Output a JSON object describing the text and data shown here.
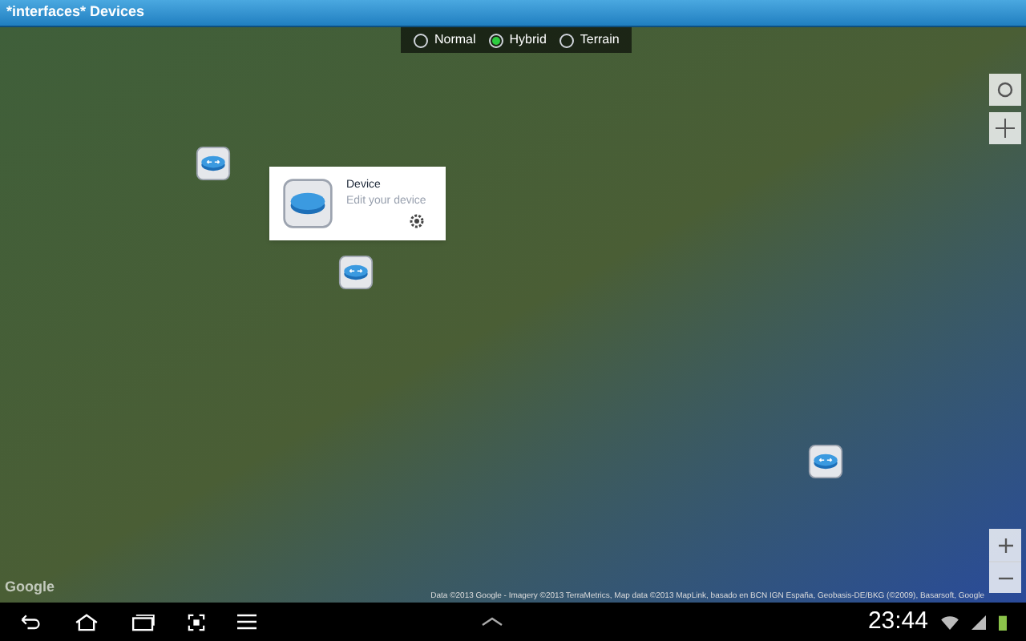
{
  "window": {
    "title": "*interfaces* Devices"
  },
  "map_types": [
    {
      "label": "Normal",
      "selected": false
    },
    {
      "label": "Hybrid",
      "selected": true
    },
    {
      "label": "Terrain",
      "selected": false
    }
  ],
  "popup": {
    "title": "Device",
    "subtitle": "Edit your device"
  },
  "map_logo": "Google",
  "attribution": "Data ©2013 Google - Imagery ©2013 TerraMetrics, Map data ©2013 MapLink, basado en BCN IGN España, Geobasis-DE/BKG (©2009), Basarsoft, Google",
  "status_bar": {
    "time": "23:44"
  }
}
